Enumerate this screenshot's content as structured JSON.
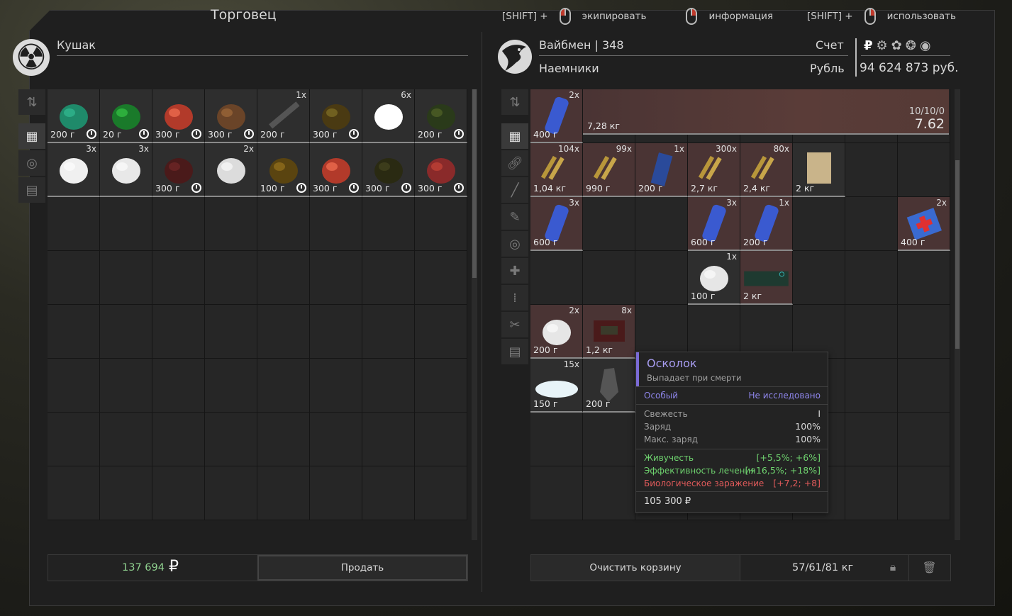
{
  "header": {
    "title": "Торговец",
    "hints": [
      {
        "key": "[SHIFT] +",
        "action": "экипировать"
      },
      {
        "key": "",
        "action": "информация"
      },
      {
        "key": "[SHIFT] +",
        "action": "использовать"
      }
    ]
  },
  "trader": {
    "name": "Кушак"
  },
  "player": {
    "name": "Вайбмен",
    "level": "348",
    "faction": "Наемники",
    "account_label": "Счет",
    "currency_label": "Рубль",
    "currency_symbol": "₽",
    "balance": "94 624 873 руб."
  },
  "left_items": [
    {
      "weight": "200 г",
      "count": "",
      "clock": true
    },
    {
      "weight": "20 г",
      "count": "",
      "clock": true
    },
    {
      "weight": "300 г",
      "count": "",
      "clock": true
    },
    {
      "weight": "300 г",
      "count": "",
      "clock": true
    },
    {
      "weight": "200 г",
      "count": "1x",
      "clock": false
    },
    {
      "weight": "300 г",
      "count": "",
      "clock": true
    },
    {
      "weight": "",
      "count": "6x",
      "clock": false
    },
    {
      "weight": "200 г",
      "count": "",
      "clock": true
    },
    {
      "weight": "",
      "count": "3x",
      "clock": false
    },
    {
      "weight": "",
      "count": "3x",
      "clock": false
    },
    {
      "weight": "300 г",
      "count": "",
      "clock": true
    },
    {
      "weight": "",
      "count": "2x",
      "clock": false
    },
    {
      "weight": "100 г",
      "count": "",
      "clock": true
    },
    {
      "weight": "300 г",
      "count": "",
      "clock": true
    },
    {
      "weight": "300 г",
      "count": "",
      "clock": true
    },
    {
      "weight": "300 г",
      "count": "",
      "clock": true
    }
  ],
  "weapon": {
    "count": "2x",
    "first_weight": "400 г",
    "weight": "7,28 кг",
    "durability": "10/10/0",
    "caliber": "7.62"
  },
  "right_items": {
    "row1": [
      {
        "weight": "1,04 кг",
        "count": "104x"
      },
      {
        "weight": "990 г",
        "count": "99x"
      },
      {
        "weight": "200 г",
        "count": "1x"
      },
      {
        "weight": "2,7 кг",
        "count": "300x"
      },
      {
        "weight": "2,4 кг",
        "count": "80x"
      },
      {
        "weight": "2 кг",
        "count": ""
      }
    ],
    "row2": [
      {
        "weight": "600 г",
        "count": "3x"
      },
      {
        "weight": "600 г",
        "count": "3x"
      },
      {
        "weight": "200 г",
        "count": "1x"
      },
      {
        "weight": "400 г",
        "count": "2x"
      }
    ],
    "row3": [
      {
        "weight": "100 г",
        "count": "1x"
      },
      {
        "weight": "2 кг",
        "count": ""
      }
    ],
    "row4": [
      {
        "weight": "200 г",
        "count": "2x"
      },
      {
        "weight": "1,2 кг",
        "count": "8x"
      }
    ],
    "row5": [
      {
        "weight": "150 г",
        "count": "15x"
      },
      {
        "weight": "200 г",
        "count": ""
      }
    ]
  },
  "tooltip": {
    "name": "Осколок",
    "subtitle": "Выпадает при смерти",
    "rarity": "Особый",
    "study": "Не исследовано",
    "stats": [
      {
        "label": "Свежесть",
        "value": "I"
      },
      {
        "label": "Заряд",
        "value": "100%"
      },
      {
        "label": "Макс. заряд",
        "value": "100%"
      }
    ],
    "effects": [
      {
        "label": "Живучесть",
        "value": "[+5,5%; +6%]",
        "color": "#6fd36f"
      },
      {
        "label": "Эффективность лечения",
        "value": "[+16,5%; +18%]",
        "color": "#6fd36f"
      },
      {
        "label": "Биологическое заражение",
        "value": "[+7,2; +8]",
        "color": "#e05a5a"
      }
    ],
    "price": "105 300 ₽"
  },
  "footer": {
    "money": "137 694",
    "currency_glyph": "₽",
    "sell": "Продать",
    "clear": "Очистить корзину",
    "weight": "57/61/81 кг"
  },
  "colors": {
    "accent_purple": "#7b6bd6",
    "money_green": "#8fd18f",
    "negative_red": "#e05a5a"
  }
}
